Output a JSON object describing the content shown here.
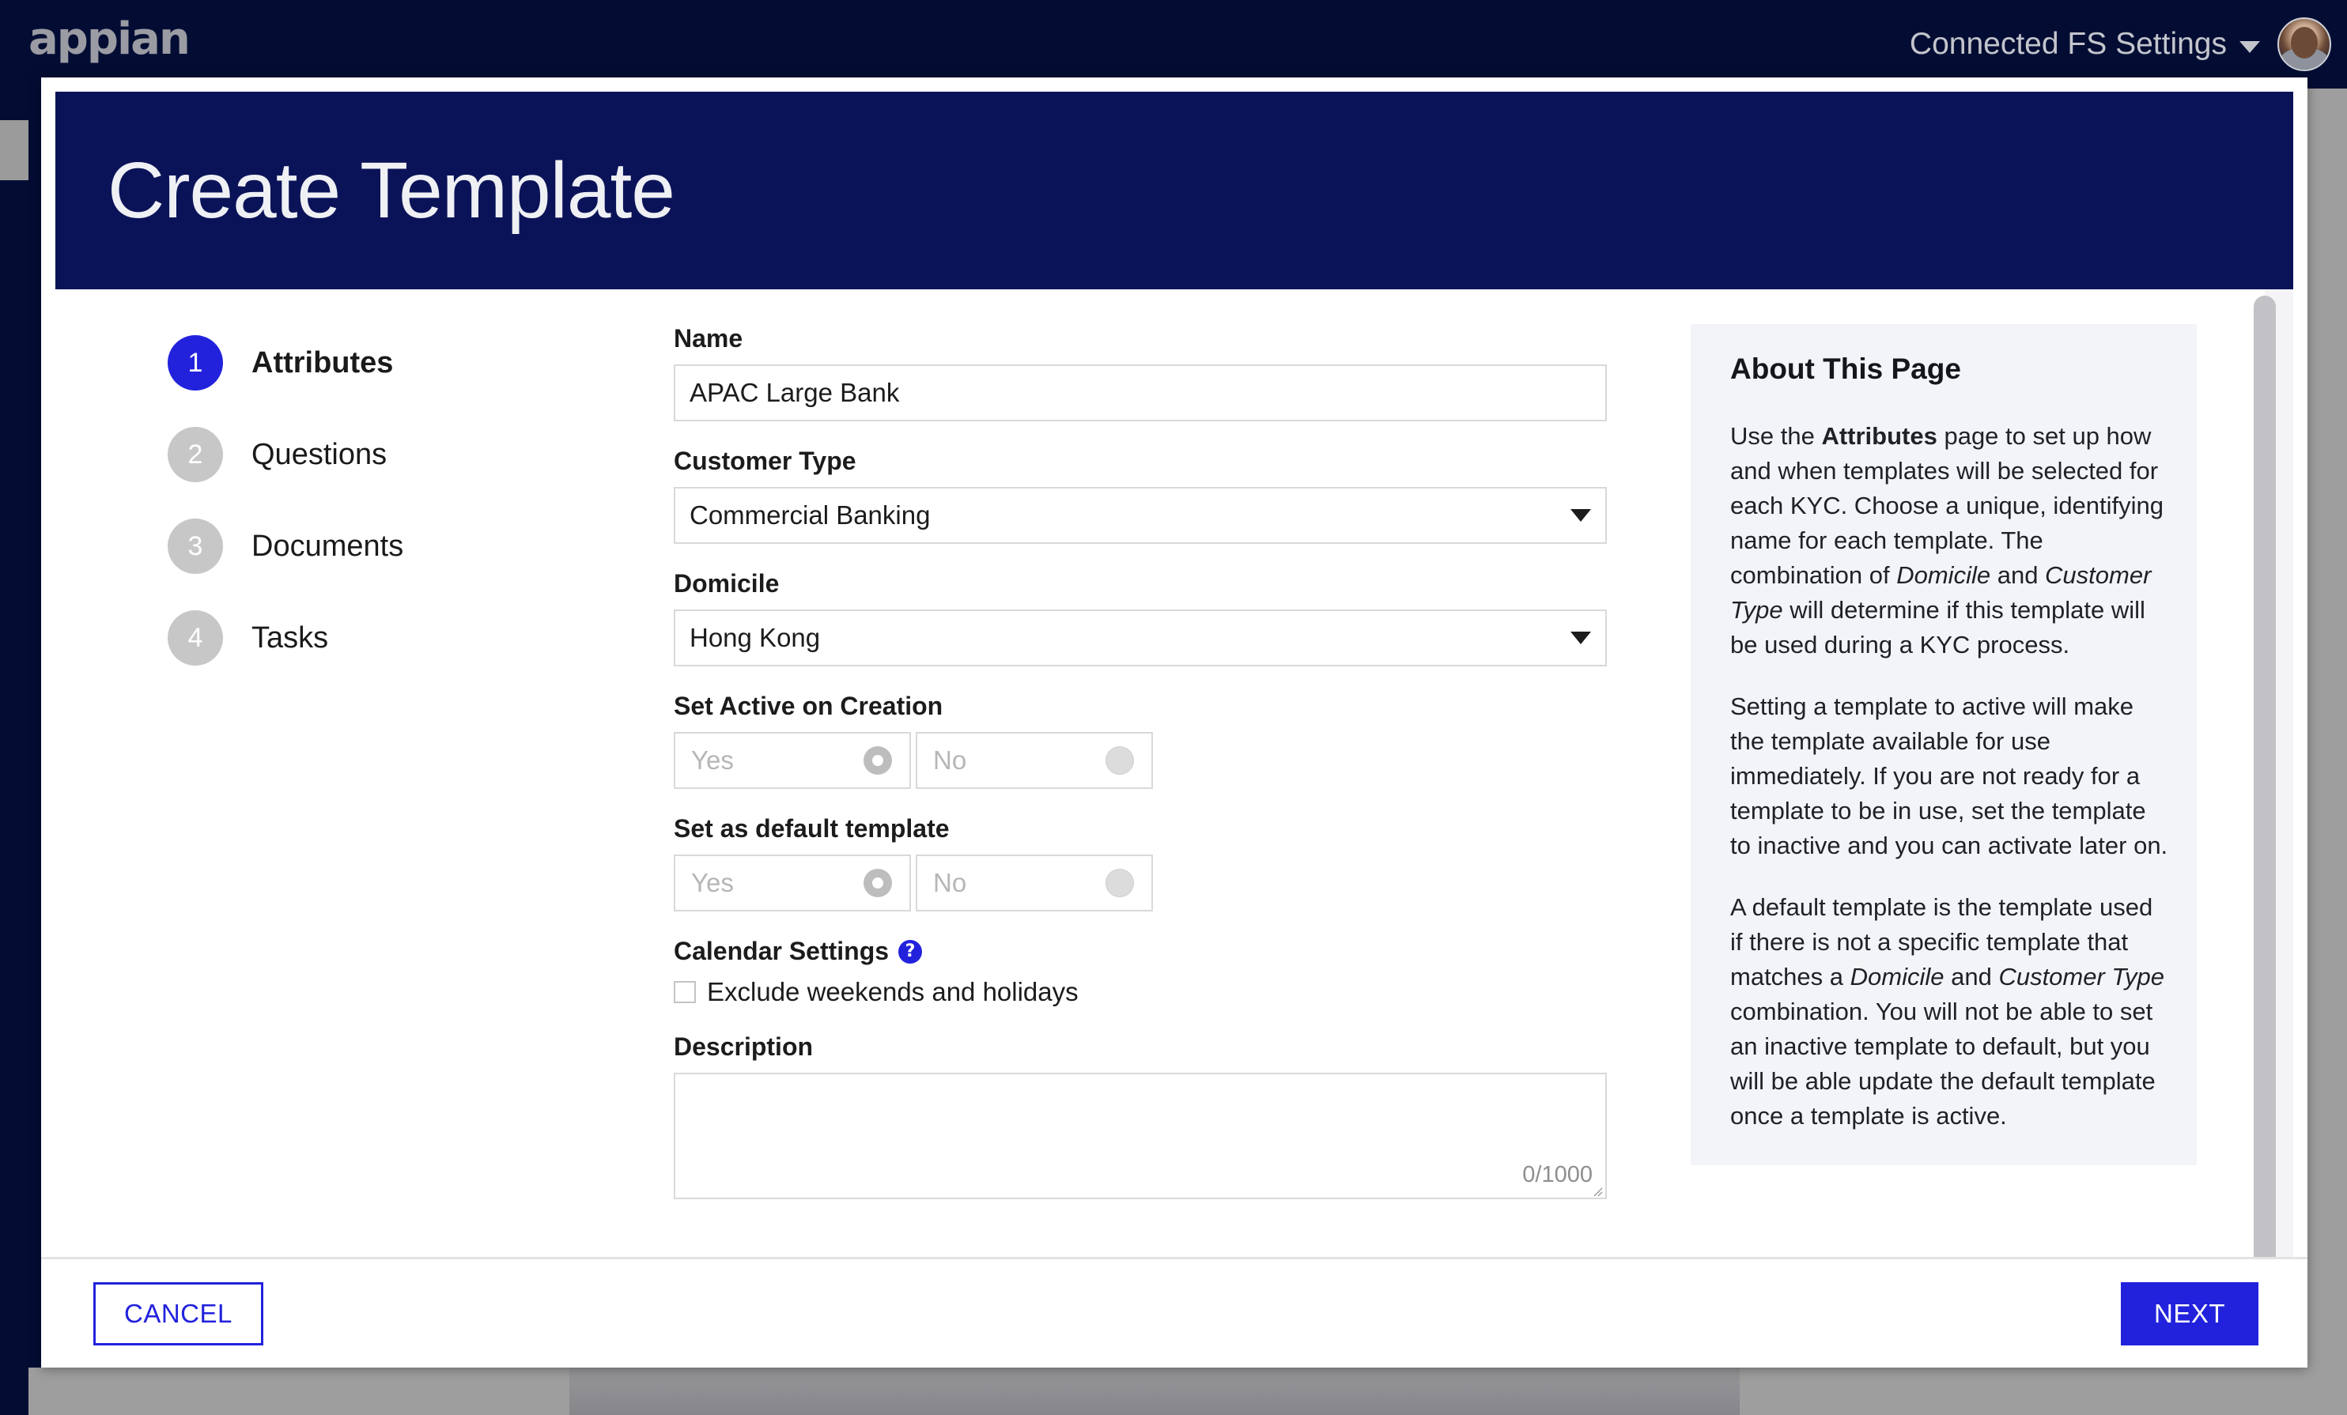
{
  "topbar": {
    "logo_text": "appian",
    "settings_label": "Connected FS Settings",
    "caret_icon": "chevron-down-icon",
    "avatar_icon": "user-avatar"
  },
  "modal": {
    "title": "Create Template"
  },
  "steps": [
    {
      "number": "1",
      "label": "Attributes",
      "active": true
    },
    {
      "number": "2",
      "label": "Questions",
      "active": false
    },
    {
      "number": "3",
      "label": "Documents",
      "active": false
    },
    {
      "number": "4",
      "label": "Tasks",
      "active": false
    }
  ],
  "form": {
    "name": {
      "label": "Name",
      "value": "APAC Large Bank",
      "placeholder": ""
    },
    "customer_type": {
      "label": "Customer Type",
      "value": "Commercial Banking",
      "caret_icon": "chevron-down-icon"
    },
    "domicile": {
      "label": "Domicile",
      "value": "Hong Kong",
      "caret_icon": "chevron-down-icon"
    },
    "set_active": {
      "label": "Set Active on Creation",
      "yes_label": "Yes",
      "no_label": "No",
      "selected": "Yes"
    },
    "set_default": {
      "label": "Set as default template",
      "yes_label": "Yes",
      "no_label": "No",
      "selected": "Yes"
    },
    "calendar": {
      "label": "Calendar Settings",
      "help_icon": "question-mark-icon",
      "checkbox_label": "Exclude weekends and holidays",
      "checked": false
    },
    "description": {
      "label": "Description",
      "value": "",
      "char_count": "0/1000"
    }
  },
  "about": {
    "title": "About This Page",
    "p1_a": "Use the ",
    "p1_bold": "Attributes",
    "p1_b": " page to set up how and when templates will be selected for each KYC. Choose a unique, identifying name for each template. The combination of ",
    "p1_i1": "Domicile",
    "p1_c": " and ",
    "p1_i2": "Customer Type",
    "p1_d": " will determine if this template will be used during a KYC process.",
    "p2": "Setting a template to active will make the template available for use immediately. If you are not ready for a template to be in use, set the template to inactive and you can activate later on.",
    "p3_a": "A default template is the template used if there is not a specific template that matches a ",
    "p3_i1": "Domicile",
    "p3_b": " and ",
    "p3_i2": "Customer Type",
    "p3_c": " combination. You will not be able to set an inactive template to default, but you will be able update the default template once a template is active."
  },
  "footer": {
    "cancel_label": "CANCEL",
    "next_label": "NEXT"
  },
  "colors": {
    "brand_navy": "#030d33",
    "header_navy": "#0b1358",
    "accent_blue": "#2222dd",
    "panel_bg": "#f2f4f8"
  }
}
